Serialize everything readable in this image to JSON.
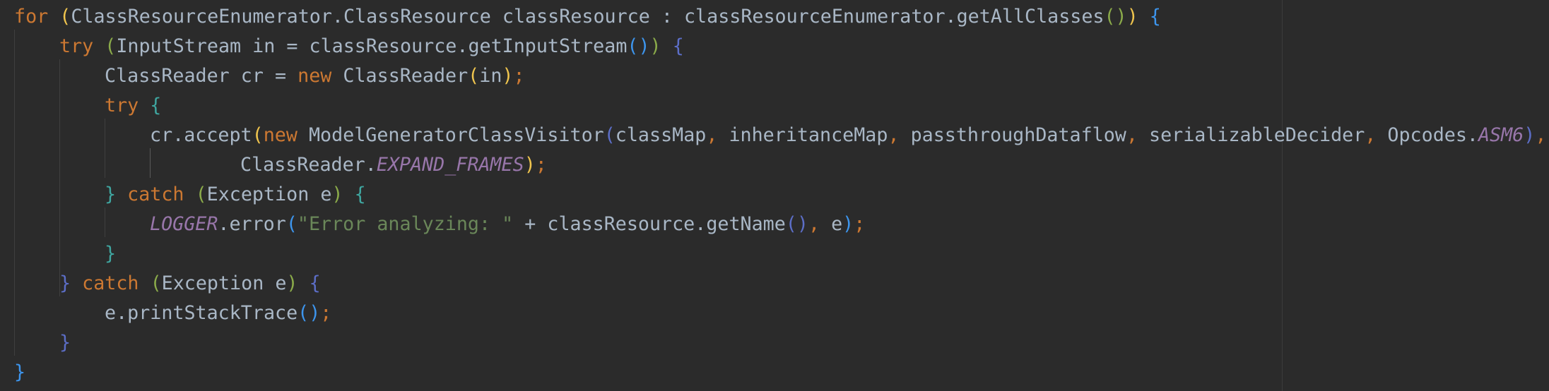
{
  "editor": {
    "lines": [
      {
        "indent": 0,
        "tokens": [
          {
            "t": "for",
            "c": "kw"
          },
          {
            "t": " ",
            "c": "plain"
          },
          {
            "t": "(",
            "c": "b1"
          },
          {
            "t": "ClassResourceEnumerator.ClassResource classResource : classResourceEnumerator.getAllClasses",
            "c": "plain"
          },
          {
            "t": "()",
            "c": "b5"
          },
          {
            "t": ")",
            "c": "b1"
          },
          {
            "t": " ",
            "c": "plain"
          },
          {
            "t": "{",
            "c": "b2"
          }
        ]
      },
      {
        "indent": 1,
        "tokens": [
          {
            "t": "try",
            "c": "kw"
          },
          {
            "t": " ",
            "c": "plain"
          },
          {
            "t": "(",
            "c": "b5"
          },
          {
            "t": "InputStream in = classResource.getInputStream",
            "c": "plain"
          },
          {
            "t": "()",
            "c": "b2"
          },
          {
            "t": ")",
            "c": "b5"
          },
          {
            "t": " ",
            "c": "plain"
          },
          {
            "t": "{",
            "c": "b3"
          }
        ]
      },
      {
        "indent": 2,
        "tokens": [
          {
            "t": "ClassReader cr = ",
            "c": "plain"
          },
          {
            "t": "new",
            "c": "kw"
          },
          {
            "t": " ClassReader",
            "c": "plain"
          },
          {
            "t": "(",
            "c": "b1"
          },
          {
            "t": "in",
            "c": "plain"
          },
          {
            "t": ")",
            "c": "b1"
          },
          {
            "t": ";",
            "c": "kw"
          }
        ]
      },
      {
        "indent": 2,
        "tokens": [
          {
            "t": "try",
            "c": "kw"
          },
          {
            "t": " ",
            "c": "plain"
          },
          {
            "t": "{",
            "c": "b4"
          }
        ]
      },
      {
        "indent": 3,
        "tokens": [
          {
            "t": "cr.accept",
            "c": "plain"
          },
          {
            "t": "(",
            "c": "b1"
          },
          {
            "t": "new",
            "c": "kw"
          },
          {
            "t": " ModelGeneratorClassVisitor",
            "c": "plain"
          },
          {
            "t": "(",
            "c": "b3"
          },
          {
            "t": "classMap",
            "c": "plain"
          },
          {
            "t": ", ",
            "c": "kw"
          },
          {
            "t": "inheritanceMap",
            "c": "plain"
          },
          {
            "t": ", ",
            "c": "kw"
          },
          {
            "t": "passthroughDataflow",
            "c": "plain"
          },
          {
            "t": ", ",
            "c": "kw"
          },
          {
            "t": "serializableDecider",
            "c": "plain"
          },
          {
            "t": ", ",
            "c": "kw"
          },
          {
            "t": "Opcodes.",
            "c": "plain"
          },
          {
            "t": "ASM6",
            "c": "const"
          },
          {
            "t": ")",
            "c": "b3"
          },
          {
            "t": ",",
            "c": "kw"
          }
        ]
      },
      {
        "indent": 5,
        "tokens": [
          {
            "t": "ClassReader.",
            "c": "plain"
          },
          {
            "t": "EXPAND_FRAMES",
            "c": "const"
          },
          {
            "t": ")",
            "c": "b1"
          },
          {
            "t": ";",
            "c": "kw"
          }
        ]
      },
      {
        "indent": 2,
        "tokens": [
          {
            "t": "}",
            "c": "b4"
          },
          {
            "t": " ",
            "c": "plain"
          },
          {
            "t": "catch",
            "c": "kw"
          },
          {
            "t": " ",
            "c": "plain"
          },
          {
            "t": "(",
            "c": "b5"
          },
          {
            "t": "Exception e",
            "c": "plain"
          },
          {
            "t": ")",
            "c": "b5"
          },
          {
            "t": " ",
            "c": "plain"
          },
          {
            "t": "{",
            "c": "b4"
          }
        ]
      },
      {
        "indent": 3,
        "tokens": [
          {
            "t": "LOGGER",
            "c": "const"
          },
          {
            "t": ".error",
            "c": "plain"
          },
          {
            "t": "(",
            "c": "b2"
          },
          {
            "t": "\"Error analyzing: \"",
            "c": "str"
          },
          {
            "t": " + classResource.getName",
            "c": "plain"
          },
          {
            "t": "()",
            "c": "b3"
          },
          {
            "t": ", ",
            "c": "kw"
          },
          {
            "t": "e",
            "c": "plain"
          },
          {
            "t": ")",
            "c": "b2"
          },
          {
            "t": ";",
            "c": "kw"
          }
        ]
      },
      {
        "indent": 2,
        "tokens": [
          {
            "t": "}",
            "c": "b4"
          }
        ]
      },
      {
        "indent": 1,
        "tokens": [
          {
            "t": "}",
            "c": "b3"
          },
          {
            "t": " ",
            "c": "plain"
          },
          {
            "t": "catch",
            "c": "kw"
          },
          {
            "t": " ",
            "c": "plain"
          },
          {
            "t": "(",
            "c": "b5"
          },
          {
            "t": "Exception e",
            "c": "plain"
          },
          {
            "t": ")",
            "c": "b5"
          },
          {
            "t": " ",
            "c": "plain"
          },
          {
            "t": "{",
            "c": "b3"
          }
        ]
      },
      {
        "indent": 2,
        "tokens": [
          {
            "t": "e.printStackTrace",
            "c": "plain"
          },
          {
            "t": "()",
            "c": "b2"
          },
          {
            "t": ";",
            "c": "kw"
          }
        ]
      },
      {
        "indent": 1,
        "tokens": [
          {
            "t": "}",
            "c": "b3"
          }
        ]
      },
      {
        "indent": 0,
        "tokens": [
          {
            "t": "}",
            "c": "b2"
          }
        ]
      }
    ]
  },
  "colors": {
    "background": "#2b2b2b",
    "keyword": "#cc7832",
    "string": "#6a8759",
    "constant": "#9876aa",
    "text": "#a9b7c6"
  }
}
